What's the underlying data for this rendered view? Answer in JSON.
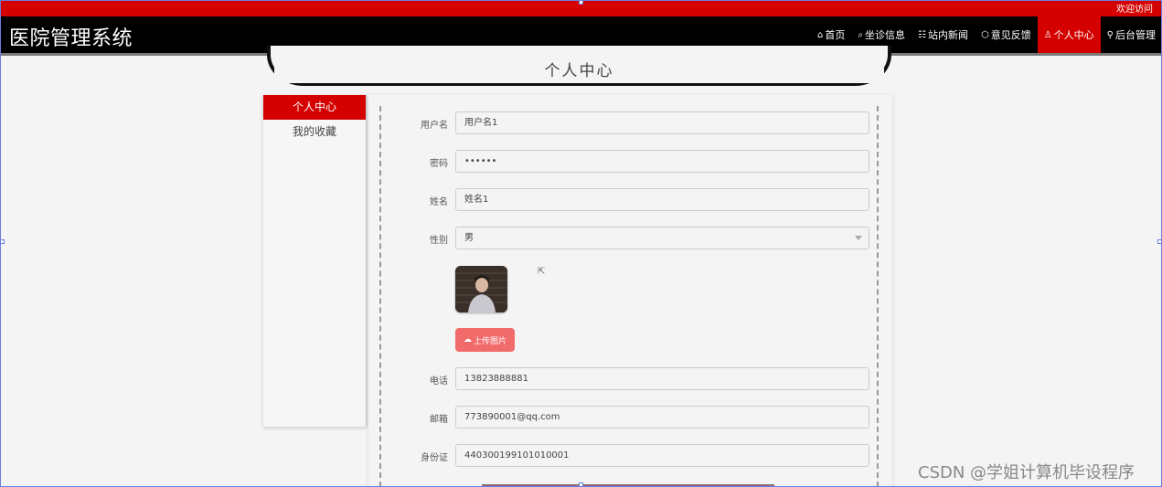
{
  "topbar": {
    "welcome": "欢迎访问"
  },
  "navbar": {
    "brand": "医院管理系统",
    "items": [
      {
        "icon": "home-icon",
        "label": "首页",
        "glyph": "⌂",
        "active": false
      },
      {
        "icon": "book-icon",
        "label": "坐诊信息",
        "glyph": "⌕",
        "active": false
      },
      {
        "icon": "news-icon",
        "label": "站内新闻",
        "glyph": "☷",
        "active": false
      },
      {
        "icon": "feedback-icon",
        "label": "意见反馈",
        "glyph": "⬡",
        "active": false
      },
      {
        "icon": "user-icon",
        "label": "个人中心",
        "glyph": "♙",
        "active": true
      },
      {
        "icon": "link-icon",
        "label": "后台管理",
        "glyph": "⚲",
        "active": false
      }
    ]
  },
  "page": {
    "title": "个人中心"
  },
  "sidebar": {
    "items": [
      {
        "label": "个人中心",
        "active": true
      },
      {
        "label": "我的收藏",
        "active": false
      }
    ]
  },
  "form": {
    "username": {
      "label": "用户名",
      "value": "用户名1"
    },
    "password": {
      "label": "密码",
      "value": "••••••"
    },
    "name": {
      "label": "姓名",
      "value": "姓名1"
    },
    "gender": {
      "label": "性别",
      "value": "男"
    },
    "upload_label": "上传图片",
    "phone": {
      "label": "电话",
      "value": "13823888881"
    },
    "email": {
      "label": "邮箱",
      "value": "773890001@qq.com"
    },
    "id_card": {
      "label": "身份证",
      "value": "440300199101010001"
    }
  },
  "watermark": "CSDN @学姐计算机毕设程序",
  "colors": {
    "primary": "#d40000",
    "nav_bg": "#000000",
    "upload": "#f26b6b"
  }
}
